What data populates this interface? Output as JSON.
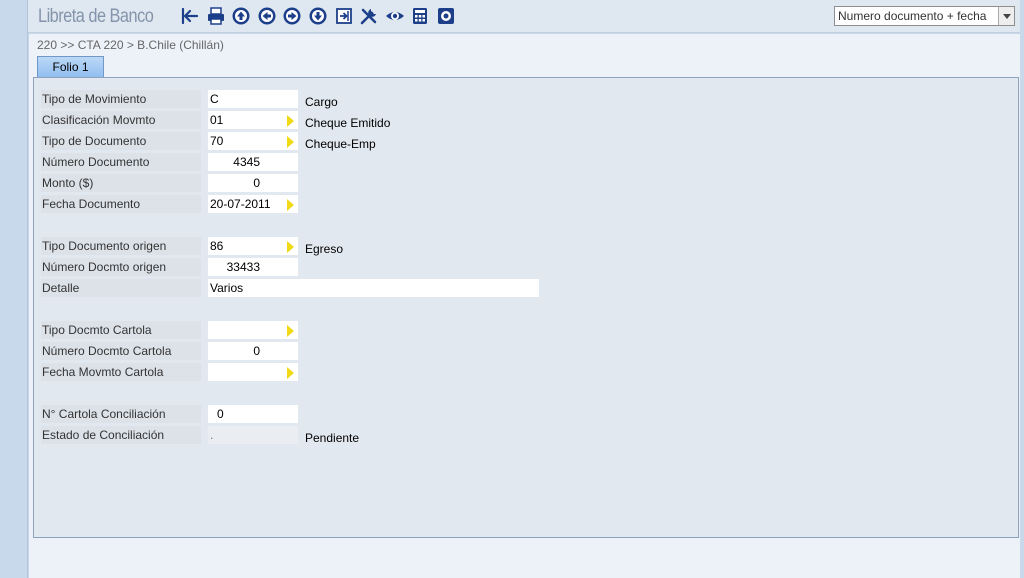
{
  "app": {
    "title": "Libreta de Banco"
  },
  "toolbar": {
    "icons": [
      "back-icon",
      "print-icon",
      "first-icon",
      "previous-icon",
      "next-icon",
      "last-icon",
      "export-icon",
      "tools-icon",
      "view-icon",
      "calculator-icon",
      "settings-icon"
    ],
    "sort": {
      "value": "Numero documento + fecha"
    }
  },
  "breadcrumb": "220 >> CTA 220 > B.Chile  (Chillán)",
  "tabs": [
    {
      "label": "Folio 1"
    }
  ],
  "colors": {
    "accent": "#8fbdef",
    "lookup_arrow": "#f0da16"
  },
  "form": {
    "tipo_movimiento": {
      "label": "Tipo de Movimiento",
      "value": "C",
      "desc": "Cargo"
    },
    "clasificacion": {
      "label": "Clasificación Movmto",
      "value": "01",
      "desc": "Cheque Emitido"
    },
    "tipo_documento": {
      "label": "Tipo de Documento",
      "value": "70",
      "desc": "Cheque-Emp"
    },
    "numero_documento": {
      "label": "Número Documento",
      "value": "4345"
    },
    "monto": {
      "label": "Monto ($)",
      "value": "0"
    },
    "fecha_documento": {
      "label": "Fecha Documento",
      "value": "20-07-2011"
    },
    "tipo_doc_origen": {
      "label": "Tipo Documento origen",
      "value": "86",
      "desc": "Egreso"
    },
    "numero_doc_origen": {
      "label": "Número Docmto origen",
      "value": "33433"
    },
    "detalle": {
      "label": "Detalle",
      "value": "Varios"
    },
    "tipo_doc_cartola": {
      "label": "Tipo Docmto Cartola",
      "value": ""
    },
    "numero_doc_cartola": {
      "label": "Número Docmto Cartola",
      "value": "0"
    },
    "fecha_mov_cartola": {
      "label": "Fecha Movmto Cartola",
      "value": " -  -"
    },
    "cartola_conciliacion": {
      "label": "N° Cartola Conciliación",
      "value": "0"
    },
    "estado_conciliacion": {
      "label": "Estado de Conciliación",
      "value": ".",
      "desc": "Pendiente"
    }
  }
}
